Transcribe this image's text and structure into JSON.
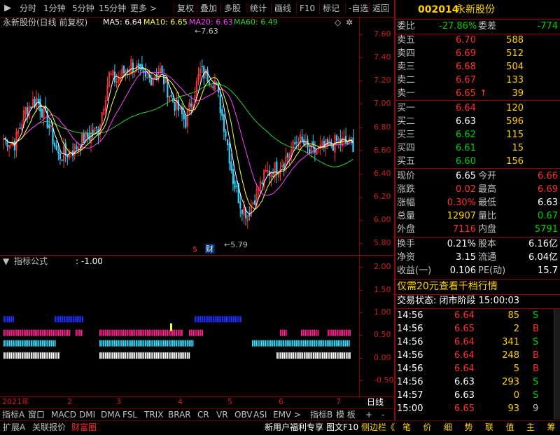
{
  "toolbar": {
    "left": [
      "分时",
      "1分钟",
      "5分钟",
      "15分钟",
      "更多 >"
    ],
    "right": [
      "复权",
      "叠加",
      "多股",
      "统计",
      "画线",
      "F10",
      "标记",
      "-自选",
      "返回"
    ]
  },
  "main": {
    "title": "永新股份(日线 前复权)",
    "ma5": "MA5: 6.64",
    "ma10": "MA10: 6.65",
    "ma20": "MA20: 6.63",
    "ma60": "MA60: 6.49",
    "high_label": "7.63",
    "low_label": "5.79",
    "yticks": [
      "7.60",
      "7.40",
      "7.20",
      "7.00",
      "6.80",
      "6.60",
      "6.40",
      "6.20",
      "6.00",
      "5.80"
    ],
    "marker_s": "$",
    "marker_cai": "财"
  },
  "indicator": {
    "title": "指标公式",
    "value": ": -1.00",
    "yticks": [
      "2.00",
      "1.50",
      "1.00",
      "0.50",
      "0.00",
      "-0.50"
    ]
  },
  "xaxis": {
    "labels": [
      "2021年",
      "2",
      "3",
      "4",
      "5",
      "6",
      "7"
    ],
    "period": "日线"
  },
  "tabs_row1": [
    "指标A",
    "窗口",
    "MACD",
    "DMI",
    "DMA",
    "FSL",
    "TRIX",
    "BRAR",
    "CR",
    "VR",
    "OBV",
    "ASI",
    "EMV",
    ">",
    "指标B",
    "模 板",
    "+",
    "-"
  ],
  "tabs_row2": {
    "left": [
      "扩展A",
      "关联报价",
      "财富圈"
    ],
    "middle": [
      "新用户福利专享",
      "图文F10",
      "侧边栏《"
    ],
    "right": [
      "笔",
      "价",
      "细",
      "势",
      "联",
      "值",
      "主",
      "筹"
    ]
  },
  "quote": {
    "code": "002014",
    "name": "永新股份",
    "weibi_label": "委比",
    "weibi": "-27.86%",
    "weicha_label": "委差",
    "weicha": "-774",
    "sell": [
      {
        "label": "卖五",
        "price": "6.70",
        "vol": "588"
      },
      {
        "label": "卖四",
        "price": "6.69",
        "vol": "512"
      },
      {
        "label": "卖三",
        "price": "6.68",
        "vol": "504"
      },
      {
        "label": "卖二",
        "price": "6.67",
        "vol": "133"
      },
      {
        "label": "卖一",
        "price": "6.65",
        "vol": "39",
        "arrow": "↑"
      }
    ],
    "buy": [
      {
        "label": "买一",
        "price": "6.64",
        "vol": "120"
      },
      {
        "label": "买二",
        "price": "6.63",
        "vol": "596"
      },
      {
        "label": "买三",
        "price": "6.62",
        "vol": "115"
      },
      {
        "label": "买四",
        "price": "6.61",
        "vol": "15"
      },
      {
        "label": "买五",
        "price": "6.60",
        "vol": "156"
      }
    ],
    "stats": [
      {
        "l1": "现价",
        "v1": "6.65",
        "l2": "今开",
        "v2": "6.66"
      },
      {
        "l1": "涨跌",
        "v1": "0.02",
        "l2": "最高",
        "v2": "6.69"
      },
      {
        "l1": "涨幅",
        "v1": "0.30%",
        "l2": "最低",
        "v2": "6.63"
      },
      {
        "l1": "总量",
        "v1": "12907",
        "l2": "量比",
        "v2": "0.67"
      },
      {
        "l1": "外盘",
        "v1": "7116",
        "l2": "内盘",
        "v2": "5791"
      }
    ],
    "stats2": [
      {
        "l1": "换手",
        "v1": "0.21%",
        "l2": "股本",
        "v2": "6.16亿"
      },
      {
        "l1": "净资",
        "v1": "3.15",
        "l2": "流通",
        "v2": "6.04亿"
      },
      {
        "l1": "收益(一)",
        "v1": "0.106",
        "l2": "PE(动)",
        "v2": "15.7"
      }
    ],
    "promo": "仅需20元查看千档行情",
    "status": "交易状态: 闭市阶段 15:00:03",
    "trades": [
      {
        "t": "14:56",
        "p": "6.64",
        "v": "85",
        "bs": "S"
      },
      {
        "t": "14:56",
        "p": "6.65",
        "v": "2",
        "bs": "B"
      },
      {
        "t": "14:56",
        "p": "6.64",
        "v": "341",
        "bs": "S"
      },
      {
        "t": "14:56",
        "p": "6.64",
        "v": "248",
        "bs": "B"
      },
      {
        "t": "14:56",
        "p": "6.64",
        "v": "5",
        "bs": "B"
      },
      {
        "t": "14:56",
        "p": "6.63",
        "v": "293",
        "bs": "S"
      },
      {
        "t": "14:57",
        "p": "6.63",
        "v": "0",
        "bs": "S"
      },
      {
        "t": "15:00",
        "p": "6.65",
        "v": "93",
        "bs": "9"
      }
    ]
  },
  "colors": {
    "up": "#ff3030",
    "down": "#30d0ff",
    "ma5": "#ffffff",
    "ma10": "#ffff30",
    "ma20": "#ff40ff",
    "ma60": "#30d030",
    "grid": "#8a0000"
  }
}
